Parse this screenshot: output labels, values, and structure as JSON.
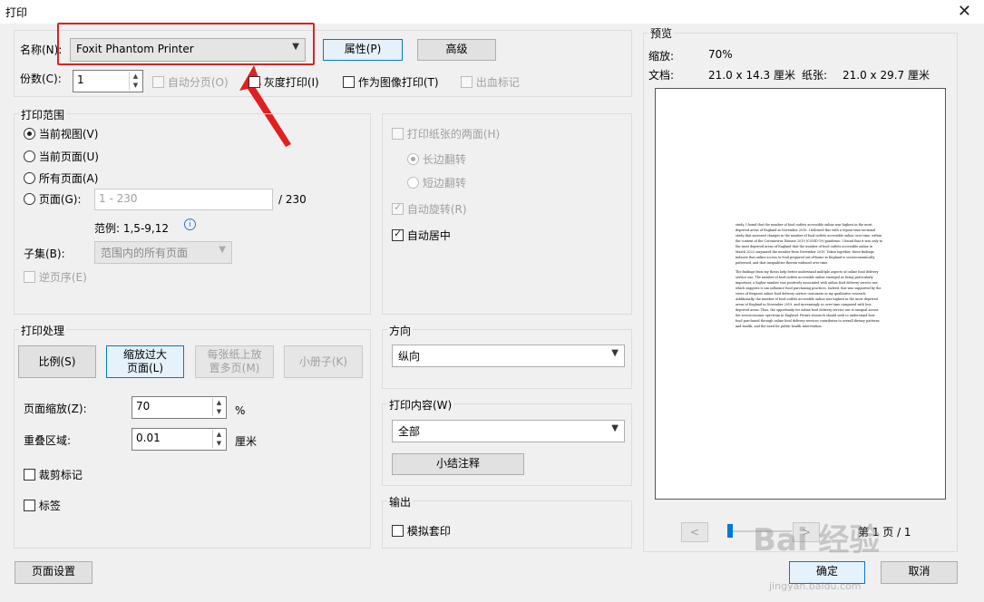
{
  "window": {
    "title": "打印",
    "close_glyph": "✕"
  },
  "printer": {
    "name_label": "名称(N):",
    "selected": "Foxit Phantom Printer",
    "properties_btn": "属性(P)",
    "advanced_btn": "高级"
  },
  "copies": {
    "label": "份数(C):",
    "value": "1",
    "collate_label": "自动分页(O)",
    "grayscale_label": "灰度打印(I)",
    "as_image_label": "作为图像打印(T)",
    "bleed_label": "出血标记"
  },
  "range": {
    "group_label": "打印范围",
    "current_view": "当前视图(V)",
    "current_page": "当前页面(U)",
    "all_pages": "所有页面(A)",
    "pages": "页面(G):",
    "pages_placeholder": "1 - 230",
    "pages_total": "/ 230",
    "example": "范例: 1,5-9,12",
    "subset_label": "子集(B):",
    "subset_value": "范围内的所有页面",
    "reverse_label": "逆页序(E)"
  },
  "duplex": {
    "both_sides": "打印纸张的两面(H)",
    "long_edge": "长边翻转",
    "short_edge": "短边翻转",
    "auto_rotate": "自动旋转(R)",
    "auto_center": "自动居中"
  },
  "handling": {
    "group_label": "打印处理",
    "scale_btn": "比例(S)",
    "fit_btn_line1": "缩放过大",
    "fit_btn_line2": "页面(L)",
    "multi_btn_line1": "每张纸上放",
    "multi_btn_line2": "置多页(M)",
    "booklet_btn": "小册子(K)",
    "zoom_label": "页面缩放(Z):",
    "zoom_value": "70",
    "zoom_unit": "%",
    "overlap_label": "重叠区域:",
    "overlap_value": "0.01",
    "overlap_unit": "厘米",
    "crop_marks": "裁剪标记",
    "labels": "标签"
  },
  "orientation": {
    "group_label": "方向",
    "value": "纵向"
  },
  "content": {
    "group_label": "打印内容(W)",
    "value": "全部",
    "summarize_btn": "小结注释"
  },
  "output": {
    "group_label": "输出",
    "simulate": "模拟套印"
  },
  "preview": {
    "group_label": "预览",
    "zoom_label": "缩放:",
    "zoom_value": "70%",
    "doc_label": "文档:",
    "doc_value": "21.0 x 14.3 厘米",
    "paper_label": "纸张:",
    "paper_value": "21.0 x 29.7 厘米",
    "para1": "study, I found that the number of food outlets accessible online was highest in the most deprived areas of England in November 2019. I followed this with a repeat time-sectional study that assessed changes in the number of food outlets accessible online over time, within the context of the Coronavirus Disease 2019 (COVID-19) pandemic. I found that it was only in the most deprived areas of England that the number of food outlets accessible online in March 2022 surpassed the number from November 2019. Taken together, these findings indicate that online access to food prepared out-of-home in England is socioeconomically patterned, and that inequalities therein widened over time.",
    "para2": "The findings from my thesis help better understand multiple aspects of online food delivery service use. The number of food outlets accessible online emerged as being particularly important, a higher number was positively associated with online food delivery service use, which suggests it can influence food purchasing practices. Indeed, this was supported by the views of frequent online food delivery service customers in my qualitative research. Additionally, the number of food outlets accessible online was highest in the most deprived areas of England in November 2019, and increasingly so over time compared with less deprived areas. Thus, the opportunity for online food delivery service use is unequal across the socioeconomic spectrum in England. Future research should seek to understand how food purchased through online food delivery services contributes to overall dietary patterns and health, and the need for public health intervention.",
    "prev_btn": "<",
    "next_btn": ">",
    "page_indicator": "第 1 页 / 1"
  },
  "footer": {
    "page_setup": "页面设置",
    "ok": "确定",
    "cancel": "取消"
  },
  "watermark": {
    "text": "Bai 经验",
    "url": "jingyan.baidu.com"
  },
  "colors": {
    "highlight": "#e02020",
    "accent": "#0078d7"
  }
}
